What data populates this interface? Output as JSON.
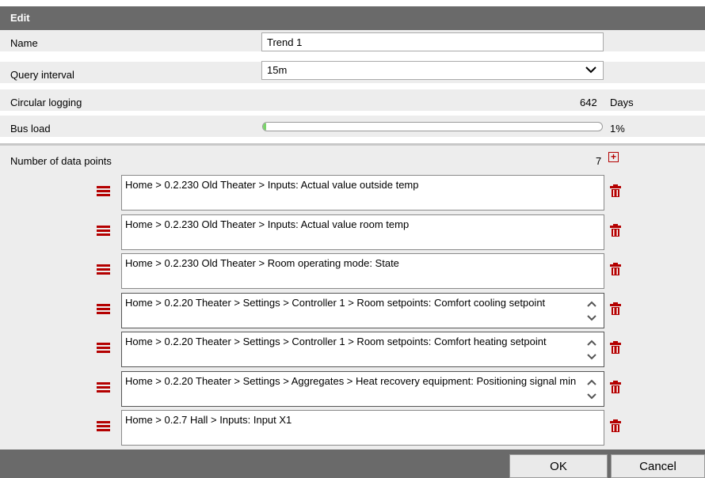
{
  "dialog": {
    "title": "Edit",
    "name_label": "Name",
    "name_value": "Trend 1",
    "query_interval_label": "Query interval",
    "query_interval_value": "15m",
    "circular_logging_label": "Circular logging",
    "circular_logging_value": "642",
    "circular_logging_unit": "Days",
    "bus_load_label": "Bus load",
    "bus_load_percent": 1,
    "bus_load_text": "1%",
    "data_points_label": "Number of data points",
    "data_points_count": "7",
    "data_points": [
      {
        "text": "Home > 0.2.230 Old Theater > Inputs: Actual value outside temp",
        "scroll": false
      },
      {
        "text": "Home > 0.2.230 Old Theater > Inputs: Actual value room temp",
        "scroll": false
      },
      {
        "text": "Home > 0.2.230 Old Theater > Room operating mode: State",
        "scroll": false
      },
      {
        "text": "Home > 0.2.20 Theater > Settings > Controller 1 > Room setpoints: Comfort cooling setpoint",
        "scroll": true
      },
      {
        "text": "Home > 0.2.20 Theater > Settings > Controller 1 > Room setpoints: Comfort heating setpoint",
        "scroll": true
      },
      {
        "text": "Home > 0.2.20 Theater > Settings > Aggregates > Heat recovery equipment: Positioning signal min",
        "scroll": true
      },
      {
        "text": "Home > 0.2.7 Hall > Inputs: Input X1",
        "scroll": false
      }
    ],
    "ok_label": "OK",
    "cancel_label": "Cancel"
  },
  "icons": {
    "add": "plus-box-icon",
    "drag": "drag-handle-icon",
    "delete": "trash-icon",
    "dropdown": "chevron-down-icon"
  },
  "colors": {
    "accent_red": "#b40000",
    "titlebar": "#6a6a6a",
    "row_bg": "#ededed",
    "progress_fill": "#7ad36a"
  }
}
